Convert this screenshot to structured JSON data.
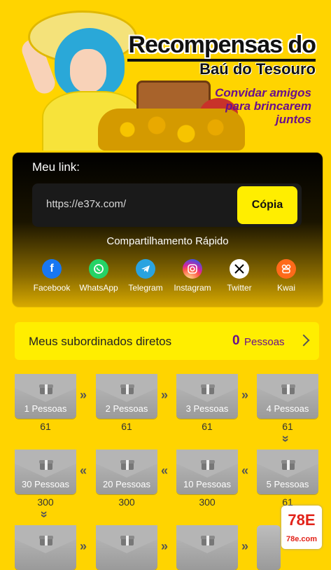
{
  "hero": {
    "title_line1": "Recompensas do",
    "title_line2": "Baú do Tesouro",
    "subtitle": "Convidar amigos para brincarem juntos"
  },
  "link_panel": {
    "label": "Meu link:",
    "url": "https://e37x.com/",
    "copy_label": "Cópia",
    "share_title": "Compartilhamento Rápido",
    "share_items": [
      {
        "label": "Facebook",
        "icon": "facebook-icon",
        "color": "#1877f2"
      },
      {
        "label": "WhatsApp",
        "icon": "whatsapp-icon",
        "color": "#25d366"
      },
      {
        "label": "Telegram",
        "icon": "telegram-icon",
        "color": "#2aa3e0"
      },
      {
        "label": "Instagram",
        "icon": "instagram-icon",
        "color": "#d6249f"
      },
      {
        "label": "Twitter",
        "icon": "x-icon",
        "color": "#000000"
      },
      {
        "label": "Kwai",
        "icon": "kwai-icon",
        "color": "#ff6a1a"
      }
    ]
  },
  "subordinates": {
    "label": "Meus subordinados diretos",
    "count": "0",
    "unit": "Pessoas"
  },
  "tiers": [
    {
      "label": "1 Pessoas",
      "reward": "61"
    },
    {
      "label": "2 Pessoas",
      "reward": "61"
    },
    {
      "label": "3 Pessoas",
      "reward": "61"
    },
    {
      "label": "4 Pessoas",
      "reward": "61"
    },
    {
      "label": "5 Pessoas",
      "reward": "61"
    },
    {
      "label": "10 Pessoas",
      "reward": "300"
    },
    {
      "label": "20 Pessoas",
      "reward": "300"
    },
    {
      "label": "30 Pessoas",
      "reward": "300"
    }
  ],
  "badge": {
    "logo": "78E",
    "site": "78e.com",
    "accent": "#e2231a"
  },
  "colors": {
    "background": "#ffd400",
    "accent_yellow": "#ffee00",
    "purple": "#6a0f8c"
  }
}
